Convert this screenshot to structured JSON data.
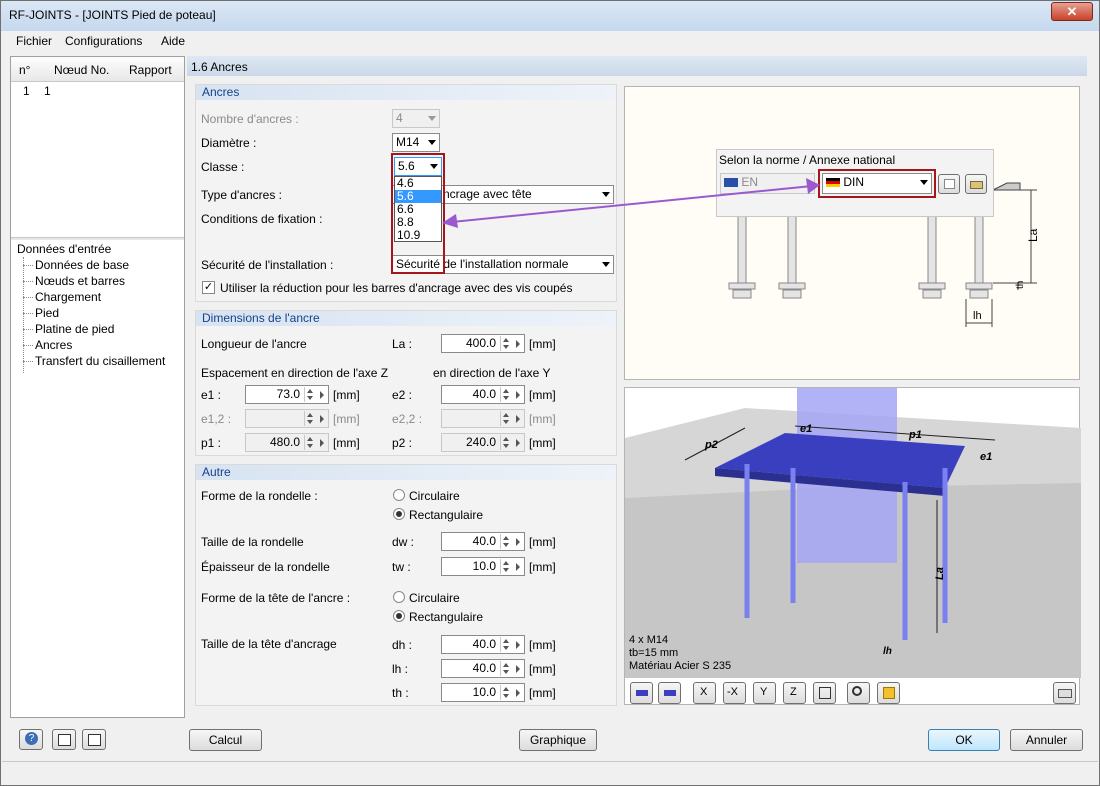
{
  "window": {
    "title": "RF-JOINTS - [JOINTS Pied de poteau]",
    "close": "✕"
  },
  "menu": [
    "Fichier",
    "Configurations",
    "Aide"
  ],
  "left": {
    "headers": {
      "n": "n°",
      "node": "Nœud No.",
      "report": "Rapport"
    },
    "rows": [
      {
        "n": "1",
        "node": "1"
      }
    ],
    "tree_root": "Données d'entrée",
    "tree": [
      "Données de base",
      "Nœuds et barres",
      "Chargement",
      "Pied",
      "Platine de pied",
      "Ancres",
      "Transfert du cisaillement"
    ]
  },
  "section_title": "1.6 Ancres",
  "anchors": {
    "header": "Ancres",
    "count_label": "Nombre d'ancres :",
    "count_value": "4",
    "diameter_label": "Diamètre :",
    "diameter_value": "M14",
    "class_label": "Classe :",
    "class_value": "5.6",
    "class_options": [
      "4.6",
      "5.6",
      "6.6",
      "8.8",
      "10.9"
    ],
    "type_label": "Type d'ancres :",
    "type_value": "ncrage avec tête",
    "fix_label": "Conditions de fixation :",
    "safety_label": "Sécurité de l'installation :",
    "safety_value": "Sécurité de l'installation normale",
    "reduction_label": "Utiliser la réduction pour les barres d'ancrage avec des vis coupés"
  },
  "dims": {
    "header": "Dimensions de l'ancre",
    "length_label": "Longueur de l'ancre",
    "la_sym": "La :",
    "la_value": "400.0",
    "unit": "[mm]",
    "z_label": "Espacement en direction de l'axe Z",
    "y_label": "en direction de l'axe Y",
    "e1_sym": "e1 :",
    "e1_value": "73.0",
    "e2_sym": "e2 :",
    "e2_value": "40.0",
    "e12_sym": "e1,2 :",
    "e22_sym": "e2,2 :",
    "p1_sym": "p1 :",
    "p1_value": "480.0",
    "p2_sym": "p2 :",
    "p2_value": "240.0"
  },
  "other": {
    "header": "Autre",
    "washer_shape_label": "Forme de la rondelle :",
    "circ": "Circulaire",
    "rect": "Rectangulaire",
    "washer_size_label": "Taille de la rondelle",
    "dw_sym": "dw :",
    "dw_value": "40.0",
    "washer_thick_label": "Épaisseur de la rondelle",
    "tw_sym": "tw :",
    "tw_value": "10.0",
    "head_shape_label": "Forme de la tête de l'ancre :",
    "head_size_label": "Taille de la tête d'ancrage",
    "dh_sym": "dh :",
    "dh_value": "40.0",
    "lh_sym": "lh :",
    "lh_value": "40.0",
    "th_sym": "th :",
    "th_value": "10.0"
  },
  "norm": {
    "label": "Selon la norme / Annexe national",
    "en": "EN",
    "din": "DIN"
  },
  "fig_top": {
    "la": "La",
    "th": "th",
    "lh": "lh"
  },
  "fig3d": {
    "info1": "4 x M14",
    "info2": "tb=15 mm",
    "info3": "Matériau Acier S 235",
    "p1": "p1",
    "p2": "p2",
    "e1": "e1",
    "la": "La",
    "lh": "lh"
  },
  "buttons": {
    "calc": "Calcul",
    "graph": "Graphique",
    "ok": "OK",
    "cancel": "Annuler"
  },
  "colors": {
    "accent": "#3399ff",
    "highlight": "#a4161a",
    "steel": "#8a8ef0",
    "arrow": "#9b59d0"
  }
}
